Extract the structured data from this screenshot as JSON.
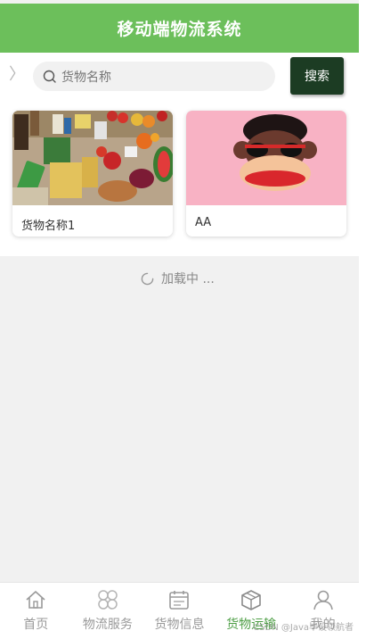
{
  "header": {
    "title": "移动端物流系统"
  },
  "search": {
    "placeholder": "货物名称",
    "button_label": "搜索"
  },
  "goods": [
    {
      "name": "货物名称1",
      "image": "groceries-photo"
    },
    {
      "name": "AA",
      "image": "monkey-sunglasses-illustration"
    }
  ],
  "loading": {
    "text": "加载中 ..."
  },
  "tabbar": {
    "items": [
      {
        "label": "首页",
        "icon": "home-icon",
        "active": false
      },
      {
        "label": "物流服务",
        "icon": "clover-icon",
        "active": false
      },
      {
        "label": "货物信息",
        "icon": "calendar-icon",
        "active": false
      },
      {
        "label": "货物运输",
        "icon": "box-icon",
        "active": true
      },
      {
        "label": "我的",
        "icon": "user-icon",
        "active": false
      }
    ]
  },
  "colors": {
    "header_bg": "#6cbf5b",
    "search_button_bg": "#1c3c23",
    "active_tab": "#4f9f47"
  },
  "watermark": "CSDN @Java毕设领航者"
}
